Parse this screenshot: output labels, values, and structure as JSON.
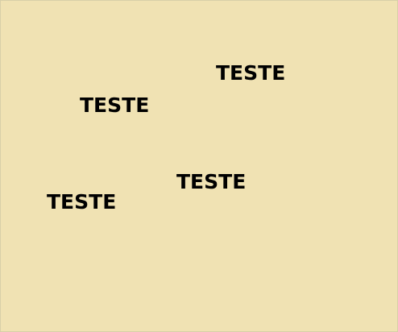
{
  "canvas": {
    "background_color": "#f0e2b3"
  },
  "labels": [
    {
      "text": "TESTE"
    },
    {
      "text": "TESTE"
    },
    {
      "text": "TESTE"
    },
    {
      "text": "TESTE"
    }
  ]
}
